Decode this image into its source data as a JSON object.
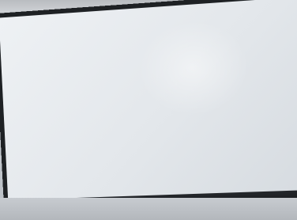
{
  "code_lines": []
}
